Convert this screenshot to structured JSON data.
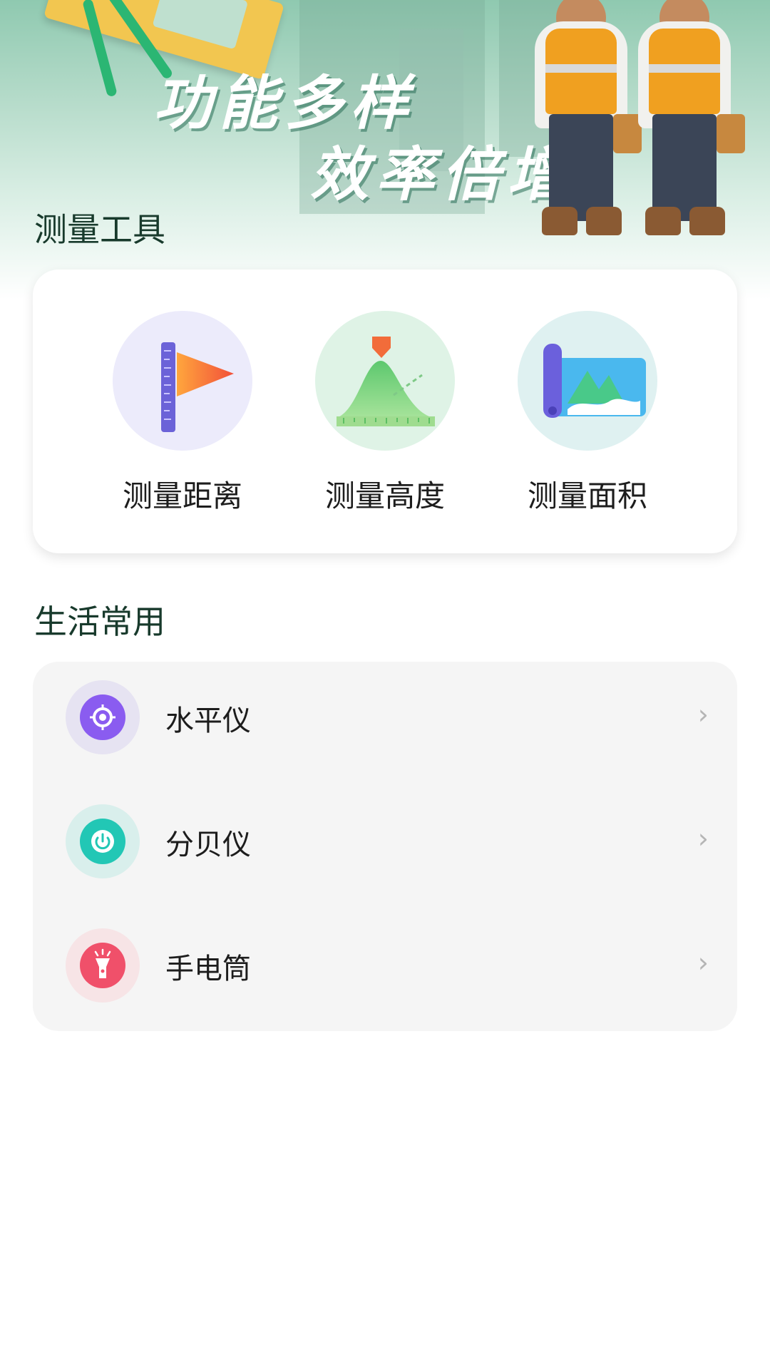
{
  "banner": {
    "slogan_line1": "功能多样",
    "slogan_line2": "效率倍增"
  },
  "measure_section": {
    "title": "测量工具",
    "tools": [
      {
        "label": "测量距离",
        "icon": "ruler-flag-icon",
        "bg": "#ecebfb"
      },
      {
        "label": "测量高度",
        "icon": "mountain-height-icon",
        "bg": "#dff3e6"
      },
      {
        "label": "测量面积",
        "icon": "map-area-icon",
        "bg": "#dff1f1"
      }
    ]
  },
  "life_section": {
    "title": "生活常用",
    "items": [
      {
        "label": "水平仪",
        "icon": "level-target-icon",
        "color": "#8a5cf0",
        "bg": "#e6e3f2"
      },
      {
        "label": "分贝仪",
        "icon": "decibel-power-icon",
        "color": "#22c7b5",
        "bg": "#d9efec"
      },
      {
        "label": "手电筒",
        "icon": "flashlight-icon",
        "color": "#f0506a",
        "bg": "#f7e4e6"
      }
    ],
    "chevron": "›"
  }
}
